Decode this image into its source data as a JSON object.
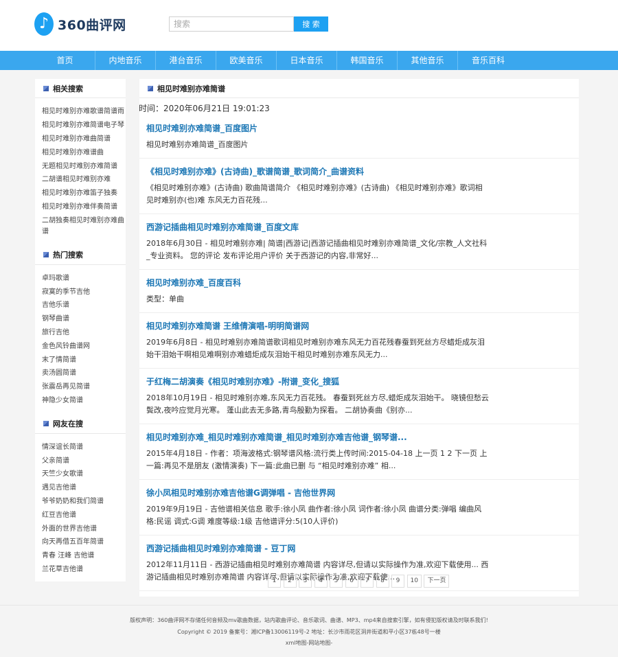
{
  "header": {
    "logo_glyph": "♪",
    "logo_text": "360曲评网",
    "search_placeholder": "搜索",
    "search_button": "搜 索"
  },
  "nav": [
    "首页",
    "内地音乐",
    "港台音乐",
    "欧美音乐",
    "日本音乐",
    "韩国音乐",
    "其他音乐",
    "音乐百科"
  ],
  "sidebar": {
    "sections": [
      {
        "title": "相关搜索",
        "items": [
          "相见时难别亦难歌谱简谱雨",
          "相见时难别亦难简谱电子琴",
          "相见时难别亦难曲简谱",
          "相见时难别亦难谱曲",
          "无题相见时难别亦难简谱",
          "二胡谱相见时难别亦难",
          "相见时难别亦难笛子独奏",
          "相见时难别亦难伴奏简谱",
          "二胡独奏相见时难别亦难曲谱"
        ]
      },
      {
        "title": "热门搜索",
        "items": [
          "卓玛歌谱",
          "寂寞的季节吉他",
          "吉他乐谱",
          "钢琴曲谱",
          "旅行吉他",
          "金色风铃曲谱网",
          "末了情简谱",
          "卖汤圆简谱",
          "张震岳再见简谱",
          "神隐少女简谱"
        ]
      },
      {
        "title": "网友在搜",
        "items": [
          "情深谊长简谱",
          "父亲简谱",
          "天竺少女歌谱",
          "遇见吉他谱",
          "爷爷奶奶和我们简谱",
          "红豆吉他谱",
          "外面的世界吉他谱",
          "向天再借五百年简谱",
          "青春 汪峰 吉他谱",
          "兰花草吉他谱"
        ]
      }
    ]
  },
  "main": {
    "title": "相见时难别亦难简谱",
    "time": "时间：2020年06月21日 19:01:23",
    "results": [
      {
        "title": "相见时难别亦难简谱_百度图片",
        "desc": "相见时难别亦难简谱_百度图片"
      },
      {
        "title": "《相见时难别亦难》(古诗曲)_歌谱简谱_歌词简介_曲谱资料",
        "desc": "《相见时难别亦难》(古诗曲) 歌曲简谱简介 《相见时难别亦难》(古诗曲) 《相见时难别亦难》歌词相见时难别亦(也)难 东风无力百花残..."
      },
      {
        "title": "西游记插曲相见时难别亦难简谱_百度文库",
        "desc": "2018年6月30日 - 相见时难别亦难| 简谱|西游记|西游记插曲相见时难别亦难简谱_文化/宗教_人文社科_专业资料。 您的评论 发布评论用户评价 关于西游记的内容,非常好..."
      },
      {
        "title": "相见时难别亦难_百度百科",
        "desc": "类型：单曲"
      },
      {
        "title": "相见时难别亦难简谱 王维倩演唱-明明简谱网",
        "desc": "2019年6月8日 - 相见时难别亦难简谱歌词相见时难别亦难东风无力百花残春蚕到死丝方尽蜡炬成灰泪始干泪始干啊相见难啊别亦难蜡炬成灰泪始干相见时难别亦难东风无力..."
      },
      {
        "title": "于红梅二胡演奏《相见时难别亦难》-附谱_变化_搜狐",
        "desc": "2018年10月19日 - 相见时难别亦难,东风无力百花残。 春蚕到死丝方尽,蜡炬成灰泪始干。 晓镜但愁云鬓改,夜吟应觉月光寒。 蓬山此去无多路,青鸟殷勤为探看。 二胡协奏曲《别亦..."
      },
      {
        "title": "相见时难别亦难_相见时难别亦难简谱_相见时难别亦难吉他谱_钢琴谱...",
        "desc": "2015年4月18日 - 作者：项海波格式:钢琴谱风格:流行类上传时间:2015-04-18 上一页 1 2 下一页 上一篇:再见不是朋友 (激情演奏) 下一篇:此曲已删 与 “相见时难别亦难” 相..."
      },
      {
        "title": "徐小凤相见时难别亦难吉他谱G调弹唱 - 吉他世界网",
        "desc": "2019年9月19日 - 吉他谱相关信息 歌手:徐小凤 曲作者:徐小凤 词作者:徐小凤 曲谱分类:弹唱 编曲风格:民谣 调式:G调 难度等级:1级 吉他谱评分:5(10人评价)"
      },
      {
        "title": "西游记插曲相见时难别亦难简谱 - 豆丁网",
        "desc": "2012年11月11日 - 西游记插曲相见时难别亦难简谱 内容详尽,但请以实际操作为准,欢迎下载使用... 西游记插曲相见时难别亦难简谱 内容详尽,但请以实际操作为准,欢迎下载使..."
      }
    ]
  },
  "pager": [
    "1",
    "2",
    "3",
    "4",
    "5",
    "6",
    "7",
    "8",
    "9",
    "10",
    "下一页"
  ],
  "footer": {
    "line1": "版权声明：360曲评网不存储任何音频及mv歌曲数据，站内歌曲评论、音乐歌词、曲谱、MP3、mp4来自搜索引擎，如有侵犯版权请及时联系我们!",
    "line2": "Copyright © 2019 备案号：湘ICP备13006119号-2 地址：长沙市雨花区洞井街道和平小区37栋48号一楼",
    "line3": "xml地图-网站地图-"
  },
  "colors": {
    "accent": "#1da1f2",
    "nav": "#3aa7ee",
    "link": "#1c77b5"
  }
}
